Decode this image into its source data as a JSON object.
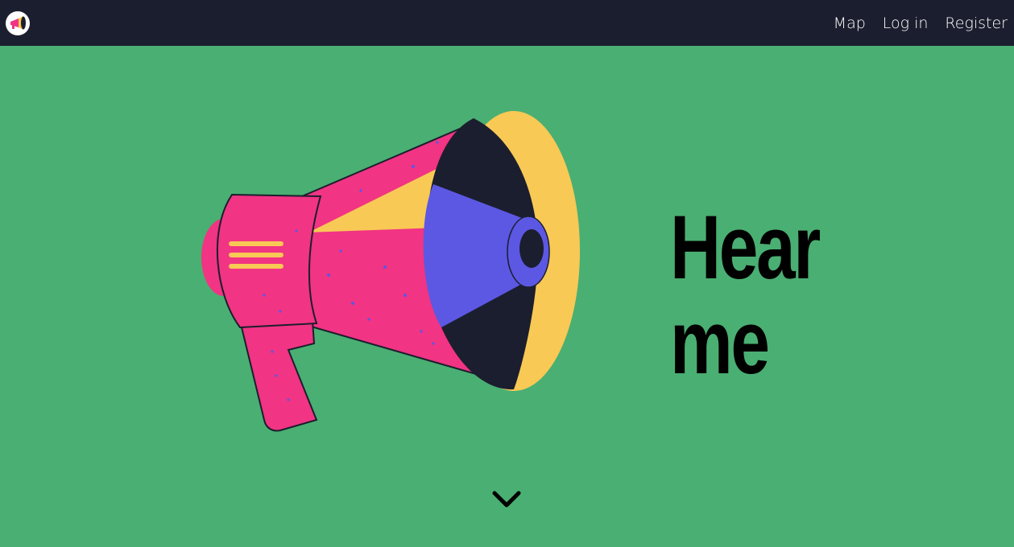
{
  "navbar": {
    "logo_icon": "megaphone-icon",
    "links": [
      {
        "label": "Map"
      },
      {
        "label": "Log in"
      },
      {
        "label": "Register"
      }
    ]
  },
  "hero": {
    "headline_line1": "Hear",
    "headline_line2": "me",
    "illustration": "megaphone-icon",
    "scroll_icon": "chevron-down-icon"
  },
  "colors": {
    "navbar_bg": "#1b1e2e",
    "page_bg": "#4aaf72",
    "megaphone_pink": "#f13483",
    "megaphone_yellow": "#f8c955",
    "megaphone_purple": "#5c58e3",
    "megaphone_dark": "#1b1e2e"
  }
}
